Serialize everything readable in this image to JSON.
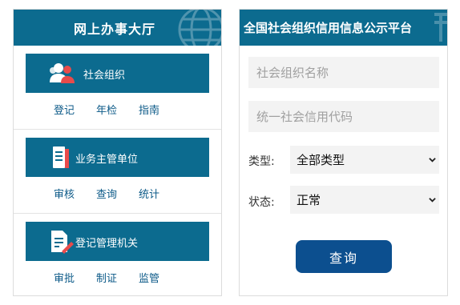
{
  "left_panel": {
    "title": "网上办事大厅",
    "sections": [
      {
        "label": "社会组织",
        "links": [
          "登记",
          "年检",
          "指南"
        ]
      },
      {
        "label": "业务主管单位",
        "links": [
          "审核",
          "查询",
          "统计"
        ]
      },
      {
        "label": "登记管理机关",
        "links": [
          "审批",
          "制证",
          "监管"
        ]
      }
    ]
  },
  "right_panel": {
    "title": "全国社会组织信用信息公示平台",
    "name_placeholder": "社会组织名称",
    "code_placeholder": "统一社会信用代码",
    "type_label": "类型:",
    "type_value": "全部类型",
    "status_label": "状态:",
    "status_value": "正常",
    "search_button": "查询"
  },
  "colors": {
    "header_blue": "#0c6b8f",
    "button_blue": "#0c4f8f",
    "link_blue": "#0c5a88",
    "input_bg": "#f3f3f3"
  },
  "icons": [
    "globe-icon",
    "people-icon",
    "document-icon",
    "edit-document-icon",
    "chevron-down-icon"
  ]
}
